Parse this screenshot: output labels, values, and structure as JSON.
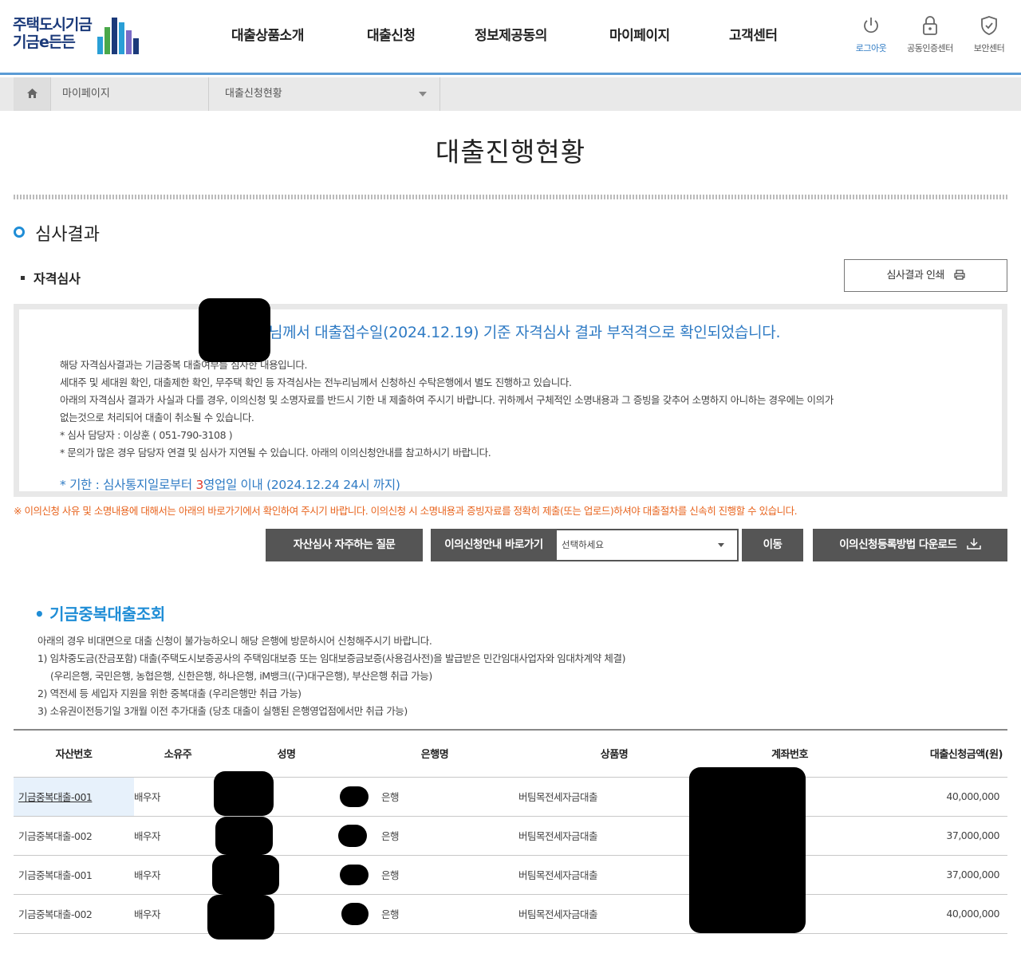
{
  "header": {
    "logo_line1": "주택도시기금",
    "logo_line2": "기금e든든",
    "nav": [
      "대출상품소개",
      "대출신청",
      "정보제공동의",
      "마이페이지",
      "고객센터"
    ],
    "util": {
      "logout": "로그아웃",
      "cert": "공동인증센터",
      "security": "보안센터"
    },
    "colors": {
      "accent": "#5b9bd5",
      "active": "#2f7bc4"
    }
  },
  "breadcrumb": {
    "level1": "마이페이지",
    "level2": "대출신청현황"
  },
  "page_title": "대출진행현황",
  "review": {
    "section_title": "심사결과",
    "sub_title": "자격심사",
    "print_button": "심사결과 인쇄",
    "result_message": "님께서 대출접수일(2024.12.19) 기준 자격심사 결과 부적격으로 확인되었습니다.",
    "lines": [
      "해당 자격심사결과는 기금중복 대출여부를 심사한 내용입니다.",
      "세대주 및 세대원 확인, 대출제한 확인, 무주택 확인 등 자격심사는 전누리님께서 신청하신 수탁은행에서 별도 진행하고 있습니다.",
      "아래의 자격심사 결과가 사실과 다를 경우, 이의신청 및 소명자료를 반드시 기한 내 제출하여 주시기 바랍니다. 귀하께서 구체적인 소명내용과 그 증빙을 갖추어 소명하지 아니하는 경우에는 이의가",
      "없는것으로 처리되어 대출이 취소될 수 있습니다.",
      "* 심사 담당자 : 이상훈 ( 051-790-3108 )",
      "* 문의가 많은 경우 담당자 연결 및 심사가 지연될 수 있습니다. 아래의 이의신청안내를 참고하시기 바랍니다."
    ],
    "deadline_prefix": "* 기한 : 심사통지일로부터 ",
    "deadline_days": "3",
    "deadline_suffix": "영업일 이내 (2024.12.24 24시 까지)"
  },
  "warning": "※ 이의신청 사유 및 소명내용에 대해서는 아래의 바로가기에서 확인하여 주시기 바랍니다. 이의신청 시 소명내용과 증빙자료를 정확히 제출(또는 업로드)하셔야 대출절차를 신속히 진행할 수 있습니다.",
  "actions": {
    "faq_button": "자산심사 자주하는 질문",
    "shortcut_label": "이의신청안내 바로가기",
    "shortcut_select": "선택하세요",
    "go_button": "이동",
    "download_button": "이의신청등록방법 다운로드"
  },
  "duplicate": {
    "title": "• 기금중복대출조회",
    "notes": [
      "아래의 경우 비대면으로 대출 신청이 불가능하오니 해당 은행에 방문하시어 신청해주시기 바랍니다.",
      "1) 임차중도금(잔금포함) 대출(주택도시보증공사의 주택임대보증 또는 임대보증금보증(사용검사전)을 발급받은 민간임대사업자와 임대차계약 체결)",
      "(우리은행, 국민은행, 농협은행, 신한은행, 하나은행, iM뱅크((구)대구은행), 부산은행  취급 가능)",
      "2) 역전세 등 세입자 지원을 위한 중복대출 (우리은행만 취급 가능)",
      "3) 소유권이전등기일 3개월 이전 추가대출 (당초 대출이 실행된 은행영업점에서만 취급 가능)"
    ],
    "columns": [
      "자산번호",
      "소유주",
      "성명",
      "은행명",
      "상품명",
      "계좌번호",
      "대출신청금액(원)"
    ],
    "rows": [
      {
        "asset": "기금중복대출-001",
        "owner": "배우자",
        "bank": "은행",
        "product": "버팀목전세자금대출",
        "amount": "40,000,000"
      },
      {
        "asset": "기금중복대출-002",
        "owner": "배우자",
        "bank": "은행",
        "product": "버팀목전세자금대출",
        "amount": "37,000,000"
      },
      {
        "asset": "기금중복대출-001",
        "owner": "배우자",
        "bank": "은행",
        "product": "버팀목전세자금대출",
        "amount": "37,000,000"
      },
      {
        "asset": "기금중복대출-002",
        "owner": "배우자",
        "bank": "은행",
        "product": "버팀목전세자금대출",
        "amount": "40,000,000"
      }
    ]
  }
}
